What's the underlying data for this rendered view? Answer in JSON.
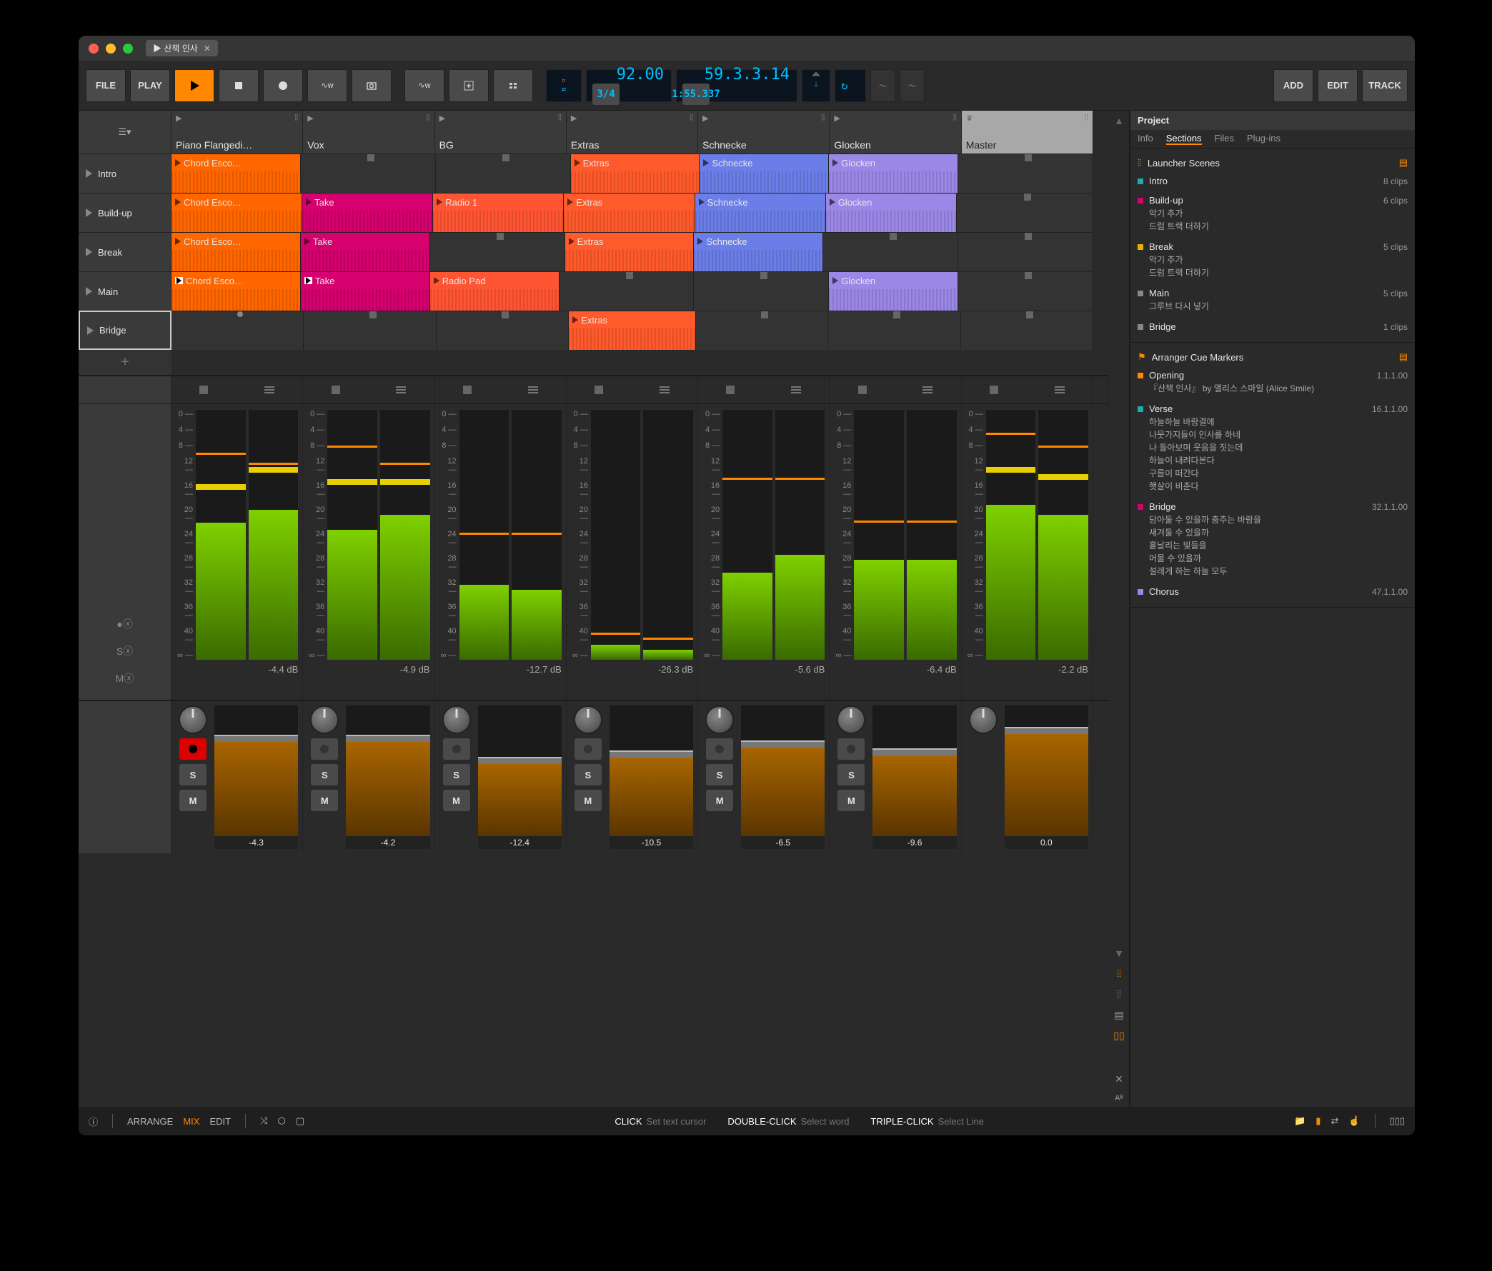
{
  "title": "▶ 산책 인사",
  "toolbar": {
    "file": "FILE",
    "play": "PLAY",
    "add": "ADD",
    "edit": "EDIT",
    "track": "TRACK"
  },
  "lcd": {
    "tempo": "92.00",
    "timesig": "3/4",
    "pos": "59.3.3.14",
    "time": "1:55.337"
  },
  "tracks": [
    {
      "name": "Piano Flangedi…",
      "color": "#ff6600"
    },
    {
      "name": "Vox",
      "color": "#d6006e"
    },
    {
      "name": "BG",
      "color": "#ff5533"
    },
    {
      "name": "Extras",
      "color": "#ff5a2b"
    },
    {
      "name": "Schnecke",
      "color": "#6b7ee8"
    },
    {
      "name": "Glocken",
      "color": "#9b87e6"
    },
    {
      "name": "Master",
      "color": "#b0b0b0"
    }
  ],
  "scenes": [
    {
      "name": "Intro",
      "cells": [
        {
          "t": "clip",
          "label": "Chord Esco…",
          "c": "#ff6600"
        },
        {
          "t": "empty"
        },
        {
          "t": "empty"
        },
        {
          "t": "clip",
          "label": "Extras",
          "c": "#ff5a2b"
        },
        {
          "t": "clip",
          "label": "Schnecke",
          "c": "#6b7ee8"
        },
        {
          "t": "clip",
          "label": "Glocken",
          "c": "#9b87e6"
        },
        {
          "t": "empty"
        }
      ]
    },
    {
      "name": "Build-up",
      "cells": [
        {
          "t": "clip",
          "label": "Chord Esco…",
          "c": "#ff6600"
        },
        {
          "t": "clip",
          "label": "Take",
          "c": "#d6006e"
        },
        {
          "t": "clip",
          "label": "Radio 1",
          "c": "#ff5533"
        },
        {
          "t": "clip",
          "label": "Extras",
          "c": "#ff5a2b"
        },
        {
          "t": "clip",
          "label": "Schnecke",
          "c": "#6b7ee8"
        },
        {
          "t": "clip",
          "label": "Glocken",
          "c": "#9b87e6"
        },
        {
          "t": "empty"
        }
      ]
    },
    {
      "name": "Break",
      "cells": [
        {
          "t": "clip",
          "label": "Chord Esco…",
          "c": "#ff6600"
        },
        {
          "t": "clip",
          "label": "Take",
          "c": "#d6006e"
        },
        {
          "t": "empty"
        },
        {
          "t": "clip",
          "label": "Extras",
          "c": "#ff5a2b"
        },
        {
          "t": "clip",
          "label": "Schnecke",
          "c": "#6b7ee8"
        },
        {
          "t": "empty"
        },
        {
          "t": "empty"
        }
      ]
    },
    {
      "name": "Main",
      "cells": [
        {
          "t": "clip",
          "label": "Chord Esco…",
          "c": "#ff6600",
          "alt": true
        },
        {
          "t": "clip",
          "label": "Take",
          "c": "#d6006e",
          "alt": true
        },
        {
          "t": "clip",
          "label": "Radio Pad",
          "c": "#ff5533"
        },
        {
          "t": "empty"
        },
        {
          "t": "empty"
        },
        {
          "t": "clip",
          "label": "Glocken",
          "c": "#9b87e6"
        },
        {
          "t": "empty"
        }
      ]
    },
    {
      "name": "Bridge",
      "sel": true,
      "cells": [
        {
          "t": "empty",
          "dot": true
        },
        {
          "t": "empty"
        },
        {
          "t": "empty"
        },
        {
          "t": "clip",
          "label": "Extras",
          "c": "#ff5a2b"
        },
        {
          "t": "empty"
        },
        {
          "t": "empty"
        },
        {
          "t": "empty"
        }
      ]
    }
  ],
  "meters": {
    "ticks": [
      "0",
      "4",
      "8",
      "12",
      "16",
      "20",
      "24",
      "28",
      "32",
      "36",
      "40",
      "∞"
    ],
    "data": [
      {
        "db": "-4.4 dB",
        "l": 55,
        "r": 60,
        "pl": 82,
        "pr": 78,
        "yl": 68,
        "yr": 75
      },
      {
        "db": "-4.9 dB",
        "l": 52,
        "r": 58,
        "pl": 85,
        "pr": 78,
        "yl": 70,
        "yr": 70
      },
      {
        "db": "-12.7 dB",
        "l": 30,
        "r": 28,
        "pl": 50,
        "pr": 50
      },
      {
        "db": "-26.3 dB",
        "l": 6,
        "r": 4,
        "pl": 10,
        "pr": 8
      },
      {
        "db": "-5.6 dB",
        "l": 35,
        "r": 42,
        "pl": 72,
        "pr": 72
      },
      {
        "db": "-6.4 dB",
        "l": 40,
        "r": 40,
        "pl": 55,
        "pr": 55
      },
      {
        "db": "-2.2 dB",
        "l": 62,
        "r": 58,
        "pl": 90,
        "pr": 85,
        "yl": 75,
        "yr": 72
      }
    ]
  },
  "faders": [
    {
      "val": "-4.3",
      "fill": 72,
      "rec": true
    },
    {
      "val": "-4.2",
      "fill": 72
    },
    {
      "val": "-12.4",
      "fill": 55
    },
    {
      "val": "-10.5",
      "fill": 60
    },
    {
      "val": "-6.5",
      "fill": 68
    },
    {
      "val": "-9.6",
      "fill": 62
    },
    {
      "val": "0.0",
      "fill": 78
    }
  ],
  "soloLbl": "S",
  "muteLbl": "M",
  "project": {
    "title": "Project",
    "tabs": [
      "Info",
      "Sections",
      "Files",
      "Plug-ins"
    ],
    "activeTab": 1,
    "launcher": {
      "title": "Launcher Scenes",
      "items": [
        {
          "name": "Intro",
          "count": "8 clips",
          "c": "#2aa",
          "sub": ""
        },
        {
          "name": "Build-up",
          "count": "6 clips",
          "c": "#d6006e",
          "sub": "악기 추가\n드럼 트랙 더하기"
        },
        {
          "name": "Break",
          "count": "5 clips",
          "c": "#e8b000",
          "sub": "악기 추가\n드럼 트랙 더하기"
        },
        {
          "name": "Main",
          "count": "5 clips",
          "c": "#888",
          "sub": "그루브 다시 넣기"
        },
        {
          "name": "Bridge",
          "count": "1 clips",
          "c": "#888",
          "sub": ""
        }
      ]
    },
    "cues": {
      "title": "Arranger Cue Markers",
      "items": [
        {
          "name": "Opening",
          "pos": "1.1.1.00",
          "c": "#ff8800",
          "sub": "『산책 인사』 by  앨리스 스마일 (Alice Smile)"
        },
        {
          "name": "Verse",
          "pos": "16.1.1.00",
          "c": "#2aa",
          "sub": "하늘하늘 바람결에\n나뭇가지들이 인사를 하네\n나 돌아보며 웃음을 짓는데\n하늘이 내려다본다\n구름이 떠간다\n햇살이 비춘다"
        },
        {
          "name": "Bridge",
          "pos": "32.1.1.00",
          "c": "#d6006e",
          "sub": "담아둘 수 있을까 춤추는 바람을\n새겨둘 수 있을까\n흩날리는 빛들을\n머물 수 있을까\n설레게 하는 하늘 모두"
        },
        {
          "name": "Chorus",
          "pos": "47.1.1.00",
          "c": "#9b87e6",
          "sub": ""
        }
      ]
    }
  },
  "statusbar": {
    "arrange": "ARRANGE",
    "mix": "MIX",
    "edit": "EDIT",
    "hints": [
      {
        "l": "CLICK",
        "v": "Set text cursor"
      },
      {
        "l": "DOUBLE-CLICK",
        "v": "Select word"
      },
      {
        "l": "TRIPLE-CLICK",
        "v": "Select Line"
      }
    ]
  }
}
